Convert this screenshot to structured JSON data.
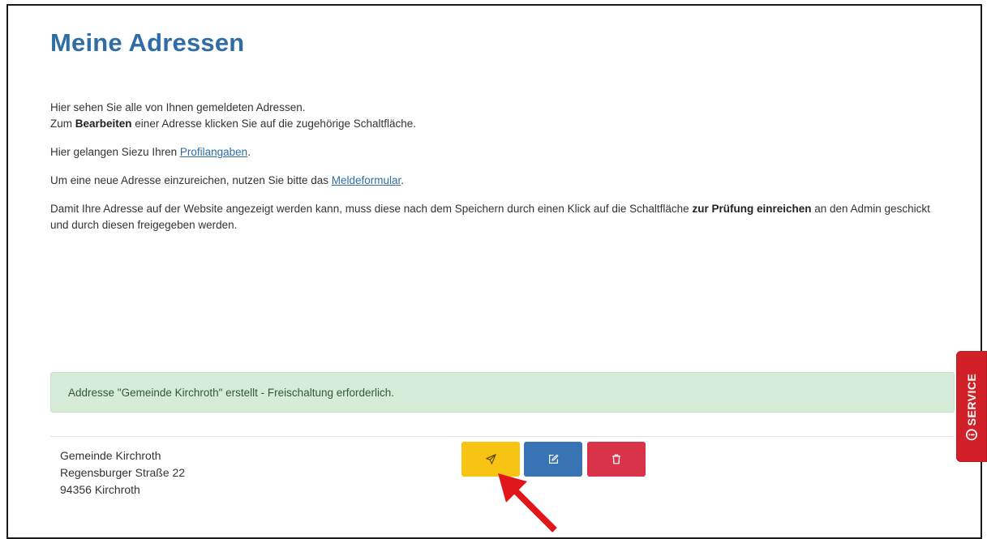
{
  "page": {
    "title": "Meine Adressen"
  },
  "intro": {
    "line1": "Hier sehen Sie alle von Ihnen gemeldeten Adressen.",
    "line2_pre": "Zum ",
    "line2_bold": "Bearbeiten",
    "line2_post": " einer Adresse klicken Sie auf die zugehörige Schaltfläche.",
    "profile_pre": "Hier gelangen Siezu Ihren ",
    "profile_link": "Profilangaben",
    "profile_post": ".",
    "form_pre": "Um eine neue Adresse einzureichen, nutzen Sie bitte das ",
    "form_link": "Meldeformular",
    "form_post": ".",
    "review_pre": "Damit Ihre Adresse auf der Website angezeigt werden kann, muss diese nach dem Speichern durch einen Klick auf die Schaltfläche ",
    "review_bold": "zur Prüfung einreichen",
    "review_post": " an den Admin geschickt und durch diesen freigegeben werden."
  },
  "alert": {
    "message": "Addresse \"Gemeinde Kirchroth\" erstellt - Freischaltung erforderlich."
  },
  "address": {
    "name": "Gemeinde Kirchroth",
    "street": "Regensburger Straße 22",
    "city": "94356 Kirchroth"
  },
  "actions": {
    "submit_icon": "paper-plane-icon",
    "edit_icon": "edit-icon",
    "delete_icon": "trash-icon"
  },
  "service_tab": {
    "label": "SERVICE",
    "icon": "info-circle-icon"
  },
  "colors": {
    "heading": "#2f6ea5",
    "link": "#2f6ea5",
    "alert_bg": "#d6ecd8",
    "alert_text": "#2f5a33",
    "submit_button": "#f8c414",
    "edit_button": "#3873b3",
    "delete_button": "#d93349",
    "service_tab": "#d12028",
    "annotation_arrow": "#e0161b"
  }
}
